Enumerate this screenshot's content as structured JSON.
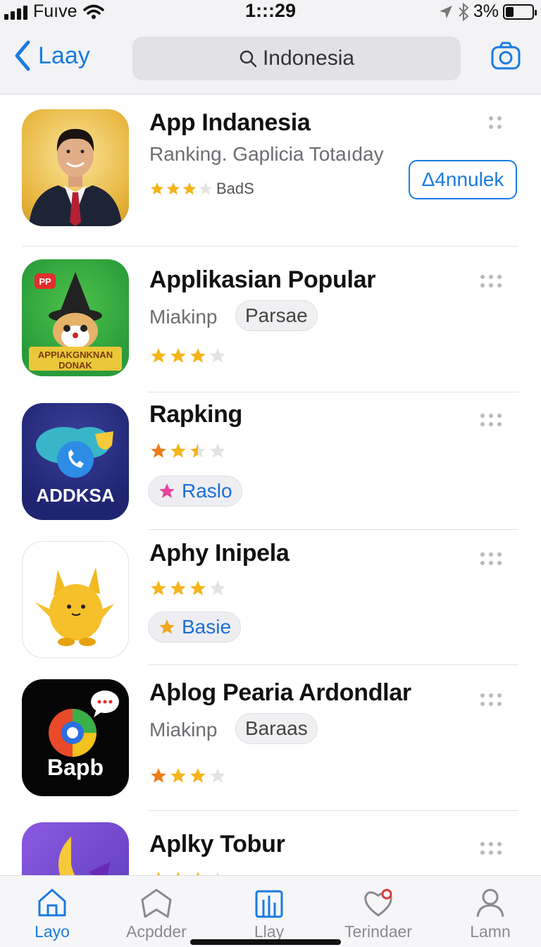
{
  "status_bar": {
    "carrier": "Fuıve",
    "time": "1:::29",
    "battery_percent_label": "3%",
    "battery_level": 0.3
  },
  "nav": {
    "back_label": "Laay",
    "search_text": "Indonesia",
    "camera_icon": "camera-icon"
  },
  "apps": [
    {
      "title": "App Indanesia",
      "subtitle": "Ranking. Gaplicia Totaıday",
      "rating": 3,
      "rating_label": "BadS",
      "action_label": "Δ4nnulek",
      "menu_dots": 4
    },
    {
      "title": "Applikasian Popular",
      "subtitle": "Miakinp",
      "chip": "Parsae",
      "rating": 3,
      "menu_dots": 6
    },
    {
      "title": "Rapking",
      "rating": 2.5,
      "chip": "Raslo",
      "chip_icon": "star-icon",
      "chip_icon_color": "#e8429a",
      "menu_dots": 6
    },
    {
      "title": "Aphy Inipela",
      "rating": 3,
      "chip": "Basie",
      "chip_icon": "star-icon",
      "chip_icon_color": "#f2a61c",
      "menu_dots": 6
    },
    {
      "title": "Aþlog Pearia Ardondlar",
      "subtitle": "Miakinp",
      "chip": "Baraas",
      "rating": 3,
      "menu_dots": 6
    },
    {
      "title": "Aplky Tobur",
      "rating": 3,
      "menu_dots": 6
    }
  ],
  "icons": {
    "app1_text": "",
    "app2_text_line1": "APPIAKGNKNAN",
    "app2_text_line2": "DONAK",
    "app2_badge": "PP",
    "app3_text": "ADDKSA",
    "app5_text": "Bapb"
  },
  "tabs": [
    {
      "label": "Layo",
      "icon": "home-icon",
      "active": true
    },
    {
      "label": "Acpdder",
      "icon": "bookmark-icon",
      "active": false
    },
    {
      "label": "Llay",
      "icon": "buildings-icon",
      "active": false
    },
    {
      "label": "Terindaer",
      "icon": "heart-icon",
      "active": false
    },
    {
      "label": "Lamn",
      "icon": "person-icon",
      "active": false
    }
  ],
  "colors": {
    "accent": "#1a7be0",
    "star": "#f5b41a",
    "star_orange": "#f07a1a",
    "star_empty": "#e3e3e6"
  }
}
